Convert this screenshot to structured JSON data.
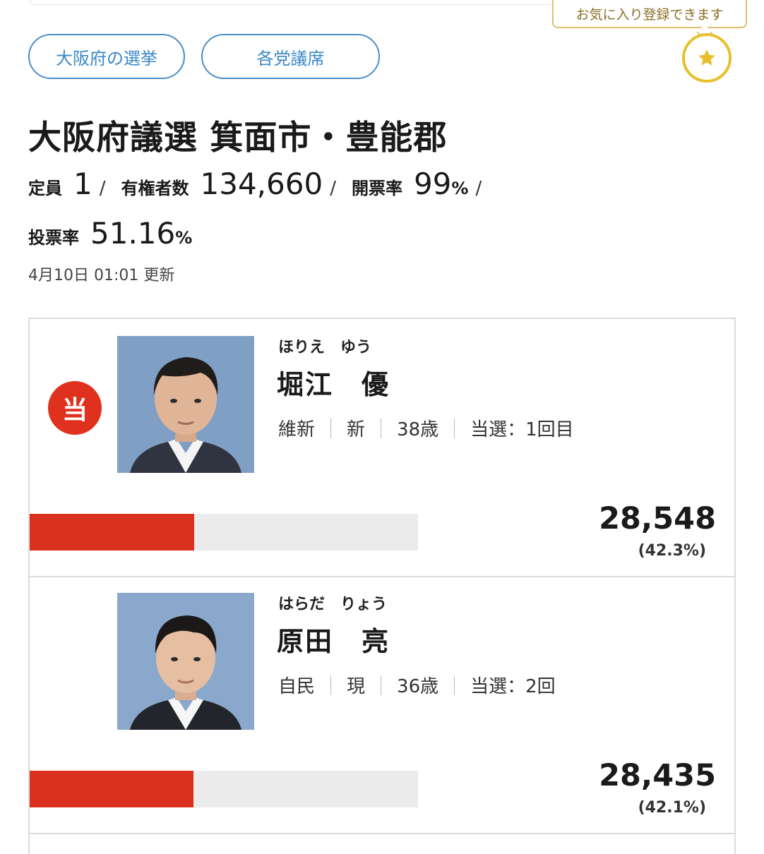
{
  "nav": {
    "pills": [
      "大阪府の選挙",
      "各党議席"
    ],
    "favorite_tooltip": "お気に入り登録できます",
    "favorite_icon": "star-icon"
  },
  "election": {
    "title": "大阪府議選 箕面市・豊能郡",
    "seats_label": "定員",
    "seats": "1",
    "electorate_label": "有権者数",
    "electorate": "134,660",
    "counted_label": "開票率",
    "counted": "99",
    "turnout_label": "投票率",
    "turnout": "51.16",
    "percent_unit": "%",
    "separator": "/",
    "updated": "4月10日 01:01 更新"
  },
  "candidates": [
    {
      "elected_badge": "当",
      "kana": "ほりえ　ゆう",
      "name": "堀江　優",
      "party": "維新",
      "status": "新",
      "age": "38歳",
      "wins": "当選：1回目",
      "votes": "28,548",
      "vote_share": "(42.3%)",
      "bar_share": 0.423
    },
    {
      "kana": "はらだ　りょう",
      "name": "原田　亮",
      "party": "自民",
      "status": "現",
      "age": "36歳",
      "wins": "当選：2回",
      "votes": "28,435",
      "vote_share": "(42.1%)",
      "bar_share": 0.421
    }
  ],
  "colors": {
    "accent_blue": "#3a88c7",
    "elected_red": "#e0301e",
    "bar_red": "#d9311e",
    "star_gold": "#e8c02d"
  }
}
